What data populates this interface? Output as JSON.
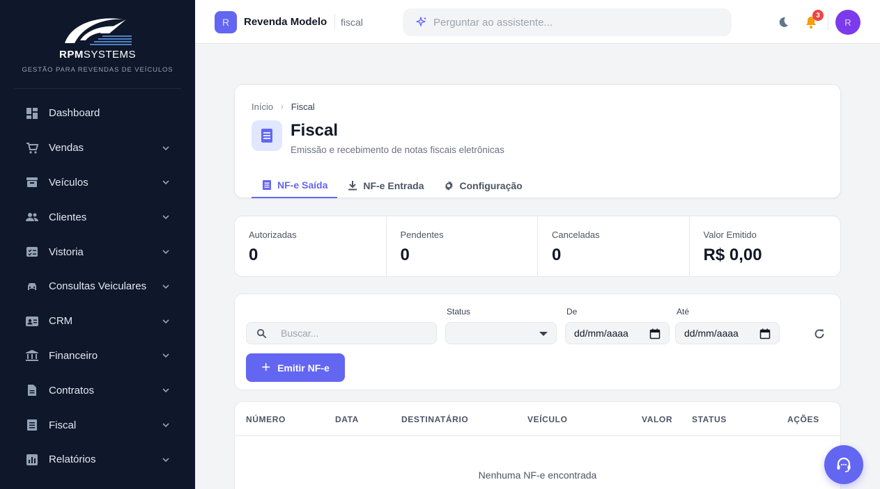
{
  "brand": {
    "name": "RPM",
    "name_suffix": "SYSTEMS",
    "tagline": "GESTÃO PARA REVENDAS DE VEÍCULOS"
  },
  "sidebar": {
    "items": [
      {
        "label": "Dashboard",
        "icon": "dashboard-icon",
        "has_children": false
      },
      {
        "label": "Vendas",
        "icon": "cart-icon",
        "has_children": true
      },
      {
        "label": "Veículos",
        "icon": "inventory-icon",
        "has_children": true
      },
      {
        "label": "Clientes",
        "icon": "people-icon",
        "has_children": true
      },
      {
        "label": "Vistoria",
        "icon": "checklist-icon",
        "has_children": true
      },
      {
        "label": "Consultas Veiculares",
        "icon": "car-icon",
        "has_children": true
      },
      {
        "label": "CRM",
        "icon": "contact-card-icon",
        "has_children": true
      },
      {
        "label": "Financeiro",
        "icon": "bank-icon",
        "has_children": true
      },
      {
        "label": "Contratos",
        "icon": "document-icon",
        "has_children": true
      },
      {
        "label": "Fiscal",
        "icon": "receipt-icon",
        "has_children": true
      },
      {
        "label": "Relatórios",
        "icon": "bar-chart-icon",
        "has_children": true
      }
    ]
  },
  "topbar": {
    "tenant_initial": "R",
    "tenant_name": "Revenda Modelo",
    "module": "fiscal",
    "assistant_placeholder": "Perguntar ao assistente...",
    "notification_count": "3",
    "user_initial": "R"
  },
  "header": {
    "breadcrumb_home": "Início",
    "breadcrumb_current": "Fiscal",
    "title": "Fiscal",
    "subtitle": "Emissão e recebimento de notas fiscais eletrônicas",
    "tabs": [
      {
        "label": "NF-e Saída",
        "icon": "receipt-icon",
        "active": true
      },
      {
        "label": "NF-e Entrada",
        "icon": "download-icon",
        "active": false
      },
      {
        "label": "Configuração",
        "icon": "gear-icon",
        "active": false
      }
    ]
  },
  "stats": [
    {
      "label": "Autorizadas",
      "value": "0"
    },
    {
      "label": "Pendentes",
      "value": "0"
    },
    {
      "label": "Canceladas",
      "value": "0"
    },
    {
      "label": "Valor Emitido",
      "value": "R$ 0,00"
    }
  ],
  "filters": {
    "search_placeholder": "Buscar...",
    "status_label": "Status",
    "status_value": "",
    "from_label": "De",
    "from_placeholder": "dd/mm/aaaa",
    "to_label": "Até",
    "to_placeholder": "dd/mm/aaaa",
    "emit_button": "Emitir NF-e"
  },
  "table": {
    "columns": [
      "NÚMERO",
      "DATA",
      "DESTINATÁRIO",
      "VEÍCULO",
      "VALOR",
      "STATUS",
      "AÇÕES"
    ],
    "empty_message": "Nenhuma NF-e encontrada"
  },
  "colors": {
    "sidebar_bg": "#0f172a",
    "accent": "#6366f1",
    "badge": "#ef4444",
    "bell": "#f59e0b"
  }
}
